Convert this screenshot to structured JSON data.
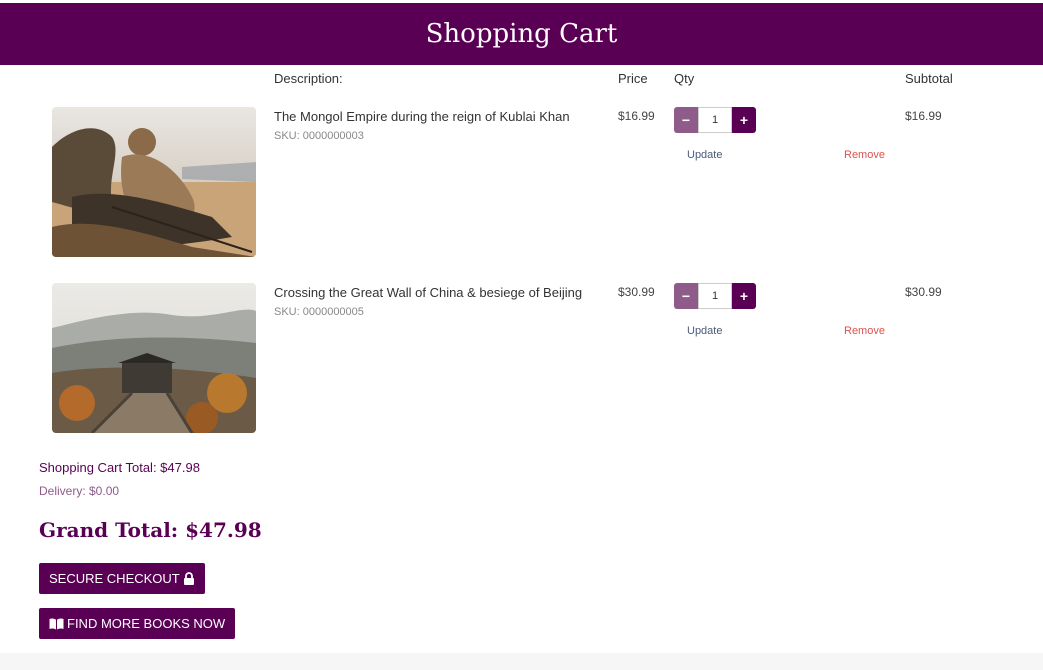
{
  "colors": {
    "brand": "#5a0054",
    "muted": "#8e5b8a",
    "remove": "#d9534f",
    "footer": "#f6f6f6"
  },
  "header": {
    "title": "Shopping Cart"
  },
  "columns": {
    "description": "Description:",
    "price": "Price",
    "qty": "Qty",
    "subtotal": "Subtotal"
  },
  "items": [
    {
      "title": "The Mongol Empire during the reign of Kublai Khan",
      "sku": "SKU: 0000000003",
      "price": "$16.99",
      "qty": "1",
      "subtotal": "$16.99",
      "update_label": "Update",
      "remove_label": "Remove",
      "minus_label": "−",
      "plus_label": "+"
    },
    {
      "title": "Crossing the Great Wall of China & besiege of Beijing",
      "sku": "SKU: 0000000005",
      "price": "$30.99",
      "qty": "1",
      "subtotal": "$30.99",
      "update_label": "Update",
      "remove_label": "Remove",
      "minus_label": "−",
      "plus_label": "+"
    }
  ],
  "summary": {
    "cart_total": "Shopping Cart Total: $47.98",
    "delivery": "Delivery: $0.00",
    "grand_total": "Grand Total: $47.98"
  },
  "actions": {
    "checkout_label": "SECURE CHECKOUT",
    "checkout_icon": "lock-icon",
    "find_more_label": "FIND MORE BOOKS NOW",
    "find_more_icon": "book-open-icon"
  }
}
